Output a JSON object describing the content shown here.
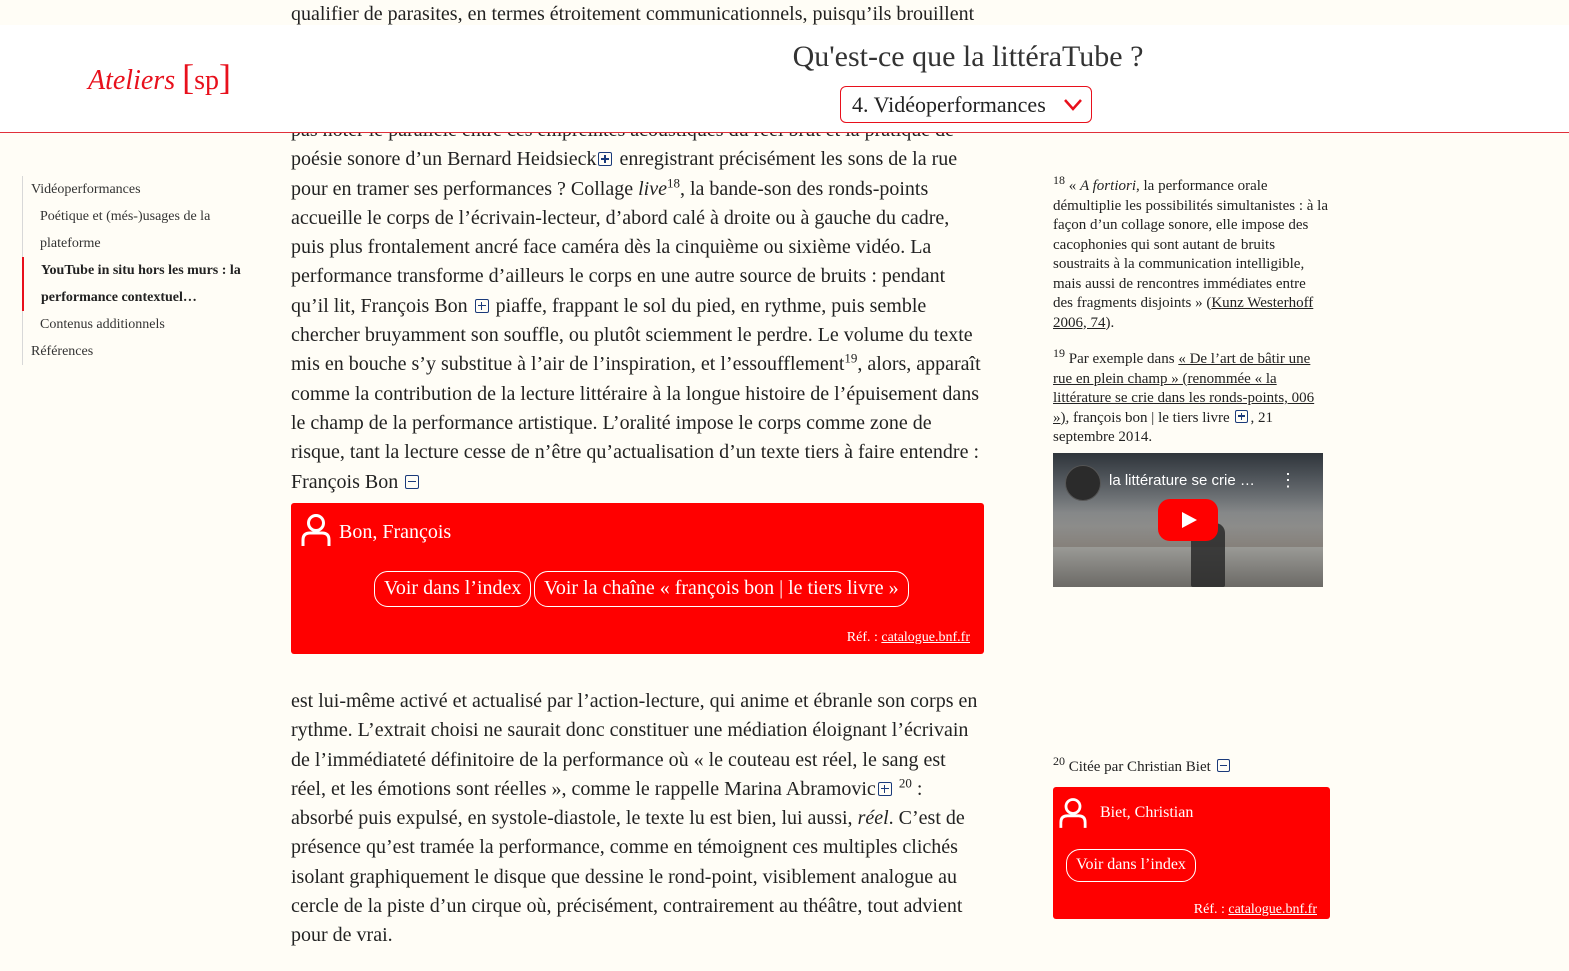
{
  "top_fragment": "qualifier de parasites, en termes étroitement communicationnels, puisqu’ils brouillent",
  "header": {
    "logo_word": "Ateliers",
    "logo_bracket_open": "[",
    "logo_sp": "sp",
    "logo_bracket_close": "]",
    "title": "Qu'est-ce que la littéraTube ?",
    "section_select": "4. Vidéoperformances"
  },
  "toc": {
    "items": [
      {
        "label": "Vidéoperformances"
      },
      {
        "label": "Poétique et (més-)usages de la plateforme"
      },
      {
        "label": "YouTube in situ hors les murs : la performance contextuel…"
      },
      {
        "label": "Contenus additionnels"
      },
      {
        "label": "Références"
      }
    ]
  },
  "main": {
    "line_partial": "pas noter le parallèle entre ces empreintes acoustiques du réel brut et la pratique de",
    "p1_a": "poésie sonore d’un Bernard Heidsieck",
    "p1_b": " enregistrant précisément les sons de la rue pour en tramer ses performances ? Collage ",
    "p1_live": "live",
    "p1_sup18": "18",
    "p1_c": ", la bande-son des ronds-points accueille le corps de l’écrivain-lecteur, d’abord calé à droite ou à gauche du cadre, puis plus frontalement ancré face caméra dès la cinquième ou sixième vidéo. La performance transforme d’ailleurs le corps en une autre source de bruits : pendant qu’il lit, François Bon",
    "p1_d": " piaffe, frappant le sol du pied, en rythme, puis semble chercher bruyamment son souffle, ou plutôt sciemment le perdre. Le volume du texte mis en bouche s’y substitue à l’air de l’inspiration, et l’essoufflement",
    "p1_sup19": "19",
    "p1_e": ", alors, apparaît comme la contribution de la lecture littéraire à la longue histoire de l’épuisement dans le champ de la performance artistique. L’oralité impose le corps comme zone de risque, tant la lecture cesse de n’être qu’actualisation d’un texte tiers à faire entendre : François Bon",
    "p2_a": "est lui-même activé et actualisé par l’action-lecture, qui anime et ébranle son corps en rythme. L’extrait choisi ne saurait donc constituer une médiation éloignant l’écrivain de l’immédiateté définitoire de la performance où « le couteau est réel, le sang est réel, et les émotions sont réelles », comme le rappelle Marina Abramovic",
    "p2_sup20": "20",
    "p2_b": " : absorbé puis expulsé, en systole-diastole, le texte lu est bien, lui aussi, ",
    "p2_reel": "réel",
    "p2_c": ". C’est de présence qu’est tramée la performance, comme en témoignent ces multiples clichés isolant graphiquement le disque que dessine le rond-point, visiblement analogue au cercle de la piste d’un cirque où, précisément, contrairement au théâtre, tout advient pour de vrai."
  },
  "card_bon": {
    "name": "Bon, François",
    "btn_index": "Voir dans l’index",
    "btn_chaine": "Voir la chaîne « françois bon | le tiers livre »",
    "ref_prefix": "Réf. : ",
    "ref_link": "catalogue.bnf.fr"
  },
  "notes": {
    "n18_num": "18",
    "n18_open": " « ",
    "n18_italic": "A fortiori",
    "n18_text": ", la performance orale démultiplie les possibilités simultanistes : à la façon d’un collage sonore, elle impose des cacophonies qui sont autant de bruits soustraits à la communication intelligible, mais aussi de rencontres immédiates entre des fragments disjoints » (",
    "n18_link": "Kunz Westerhoff 2006, 74",
    "n18_close": ").",
    "n19_num": "19",
    "n19_a": " Par exemple dans ",
    "n19_link": "« De l’art de bâtir une rue en plein champ » (renommée « la littérature se crie dans les ronds-points, 006 »)",
    "n19_b": ", françois bon | le tiers livre",
    "n19_c": ", 21 septembre 2014.",
    "video_title": "la littérature se crie …",
    "n20_num": "20",
    "n20_text": " Citée par Christian Biet"
  },
  "card_biet": {
    "name": "Biet, Christian",
    "btn_index": "Voir dans l’index",
    "ref_prefix": "Réf. : ",
    "ref_link": "catalogue.bnf.fr"
  }
}
